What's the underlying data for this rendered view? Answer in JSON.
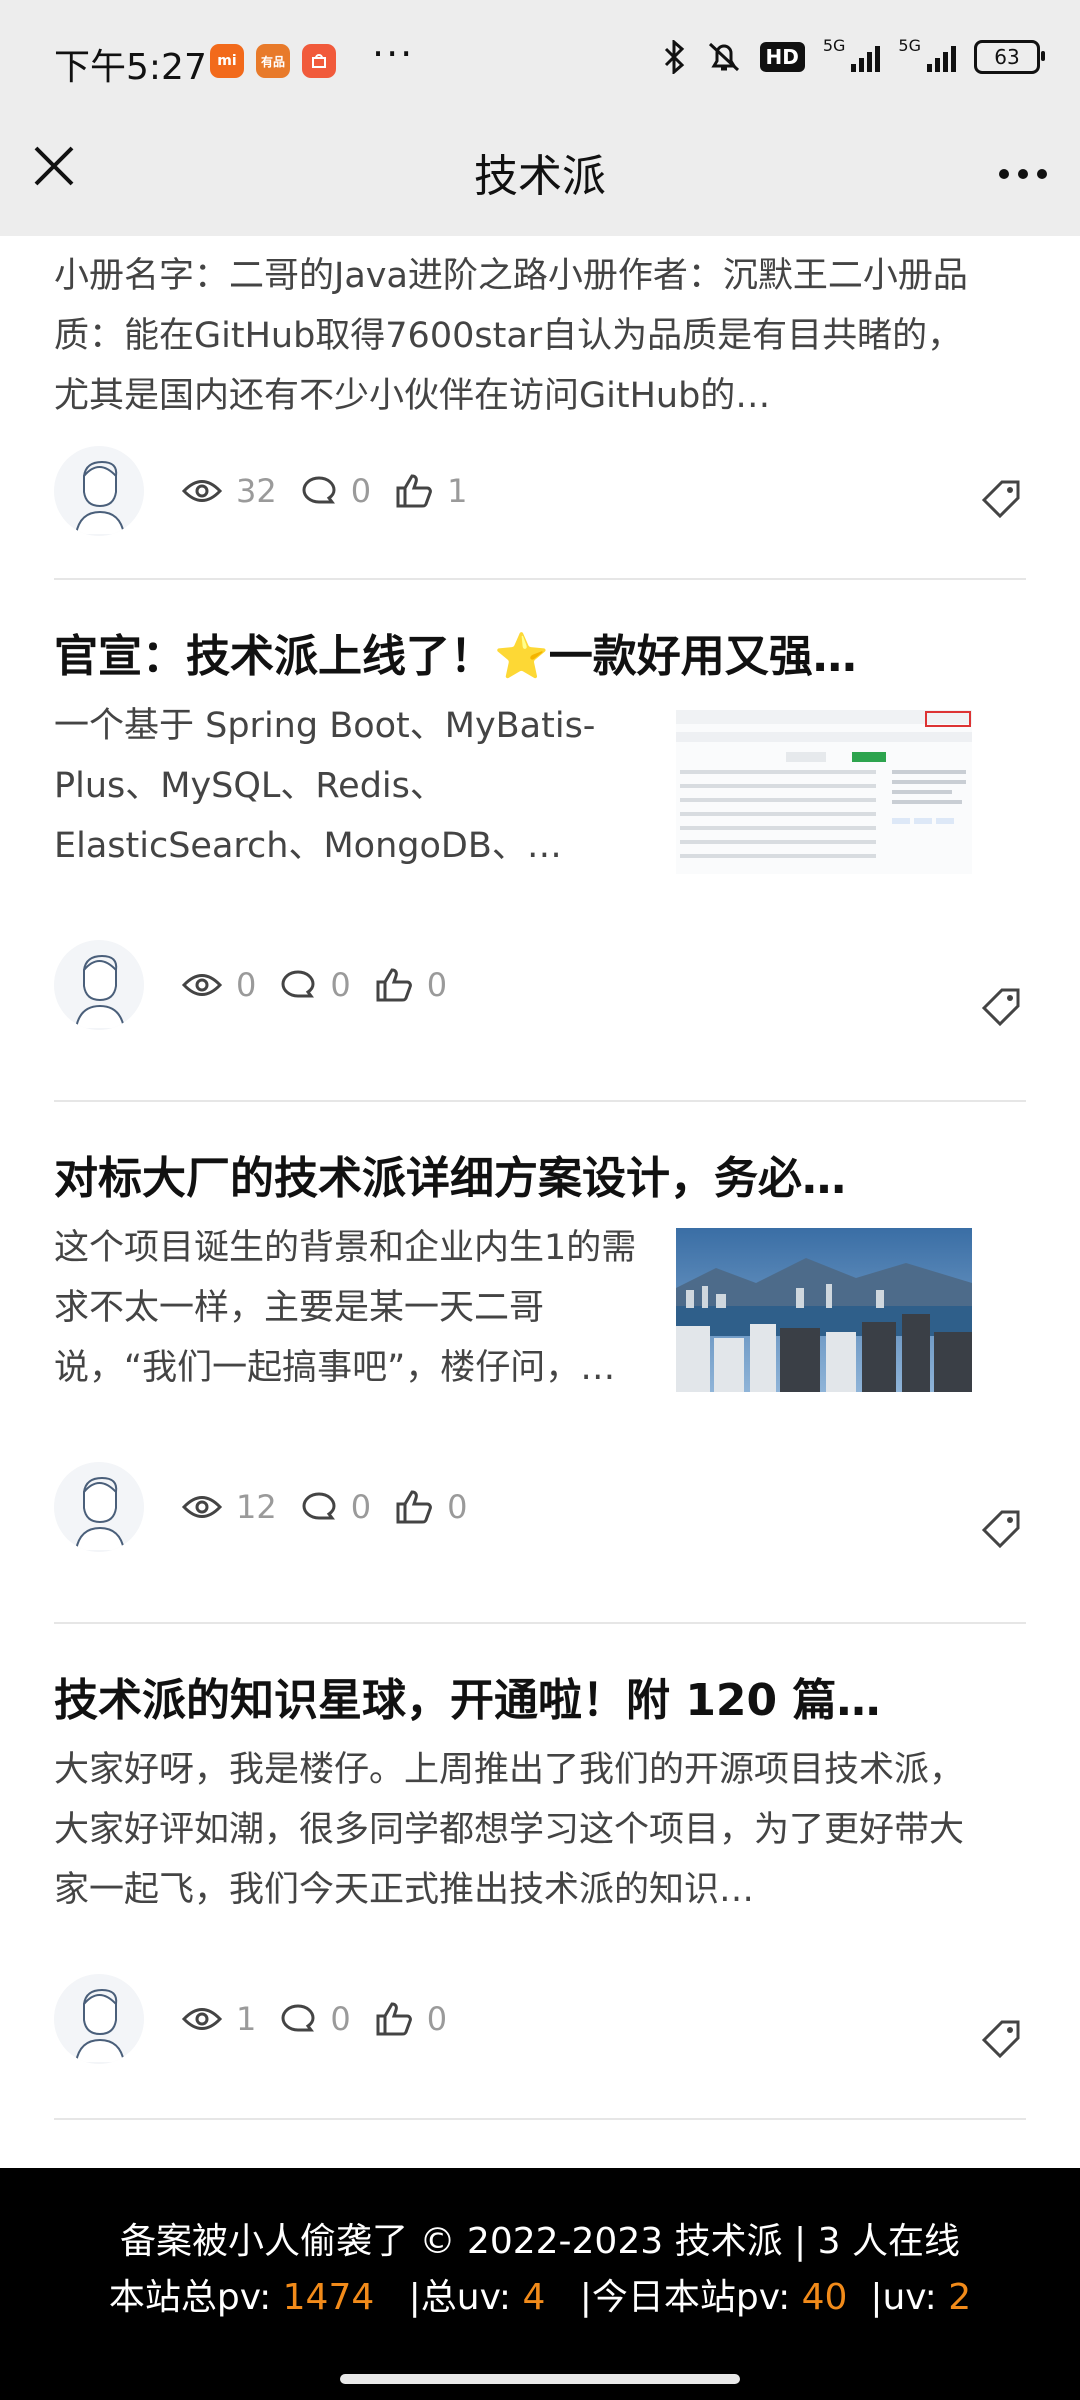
{
  "status_bar": {
    "time": "下午5:27",
    "apps": [
      {
        "name": "mi-app-icon",
        "label": "mi",
        "color": "#f26a1b"
      },
      {
        "name": "youpin-app-icon",
        "label": "有品",
        "color": "#e87a2a"
      },
      {
        "name": "mall-app-icon",
        "label": "",
        "color": "#f15a3b"
      }
    ],
    "more": "···",
    "hd_label": "HD",
    "signal_labels": [
      "5G",
      "5G"
    ],
    "battery": "63"
  },
  "title_bar": {
    "title": "技术派"
  },
  "articles": [
    {
      "title": "",
      "desc": "小册名字：二哥的Java进阶之路小册作者：沉默王二小册品质：能在GitHub取得7600star自认为品质是有目共睹的，尤其是国内还有不少小伙伴在访问GitHub的…",
      "views": "32",
      "comments": "0",
      "likes": "1"
    },
    {
      "title": "官宣：技术派上线了！⭐一款好用又强…",
      "desc": "一个基于 Spring Boot、MyBatis-Plus、MySQL、Redis、ElasticSearch、MongoDB、…",
      "views": "0",
      "comments": "0",
      "likes": "0",
      "thumb": "github-screenshot"
    },
    {
      "title": "对标大厂的技术派详细方案设计，务必…",
      "desc": "这个项目诞生的背景和企业内生1的需求不太一样，主要是某一天二哥说，“我们一起搞事吧”，楼仔问，…",
      "views": "12",
      "comments": "0",
      "likes": "0",
      "thumb": "city-harbor-photo"
    },
    {
      "title": "技术派的知识星球，开通啦！附 120 篇…",
      "desc": "大家好呀，我是楼仔。上周推出了我们的开源项目技术派，大家好评如潮，很多同学都想学习这个项目，为了更好带大家一起飞，我们今天正式推出技术派的知识…",
      "views": "1",
      "comments": "0",
      "likes": "0"
    }
  ],
  "footer": {
    "line1": "备案被小人偷袭了 © 2022-2023 技术派 | 3 人在线",
    "pv_label": "本站总pv: ",
    "pv": "1474",
    "uv_label": "总uv: ",
    "uv": "4",
    "today_pv_label": "今日本站pv: ",
    "today_pv": "40",
    "today_uv_label": "uv: ",
    "today_uv": "2",
    "sep": "|",
    "accent": "#f28b1a"
  }
}
